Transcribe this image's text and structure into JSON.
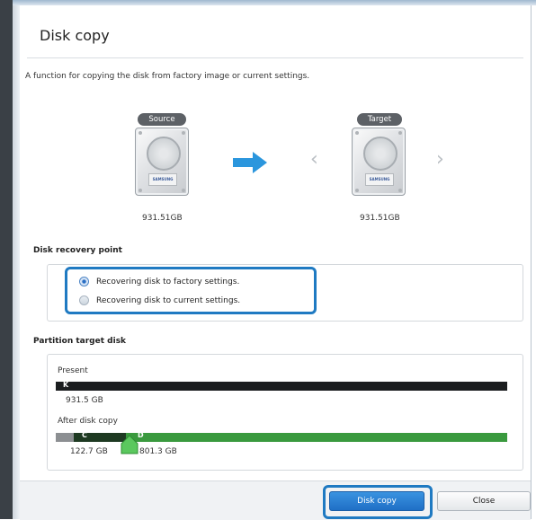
{
  "dialog": {
    "title": "Disk copy",
    "description": "A function for copying the disk from factory image or current settings."
  },
  "disks": {
    "source": {
      "badge": "Source",
      "size": "931.51GB",
      "brand": "SAMSUNG"
    },
    "target": {
      "badge": "Target",
      "size": "931.51GB",
      "brand": "SAMSUNG"
    }
  },
  "recovery": {
    "section_title": "Disk recovery point",
    "options": [
      {
        "label": "Recovering disk to factory settings.",
        "selected": true
      },
      {
        "label": "Recovering disk to current settings.",
        "selected": false
      }
    ]
  },
  "partition": {
    "section_title": "Partition target disk",
    "present": {
      "label": "Present",
      "drive_letter": "K",
      "size": "931.5 GB"
    },
    "after": {
      "label": "After disk copy",
      "partitions": [
        {
          "letter": "C",
          "size": "122.7 GB"
        },
        {
          "letter": "D",
          "size": "801.3 GB"
        }
      ]
    }
  },
  "buttons": {
    "primary": "Disk copy",
    "secondary": "Close"
  },
  "colors": {
    "accent": "#1f7ac2",
    "bar_present": "#1b1d1f",
    "bar_c": "#1e3a22",
    "bar_d": "#3a9a3e"
  },
  "icons": [
    "hard-disk-icon",
    "arrow-right-icon",
    "chevron-left-icon",
    "chevron-right-icon",
    "split-handle-icon"
  ]
}
